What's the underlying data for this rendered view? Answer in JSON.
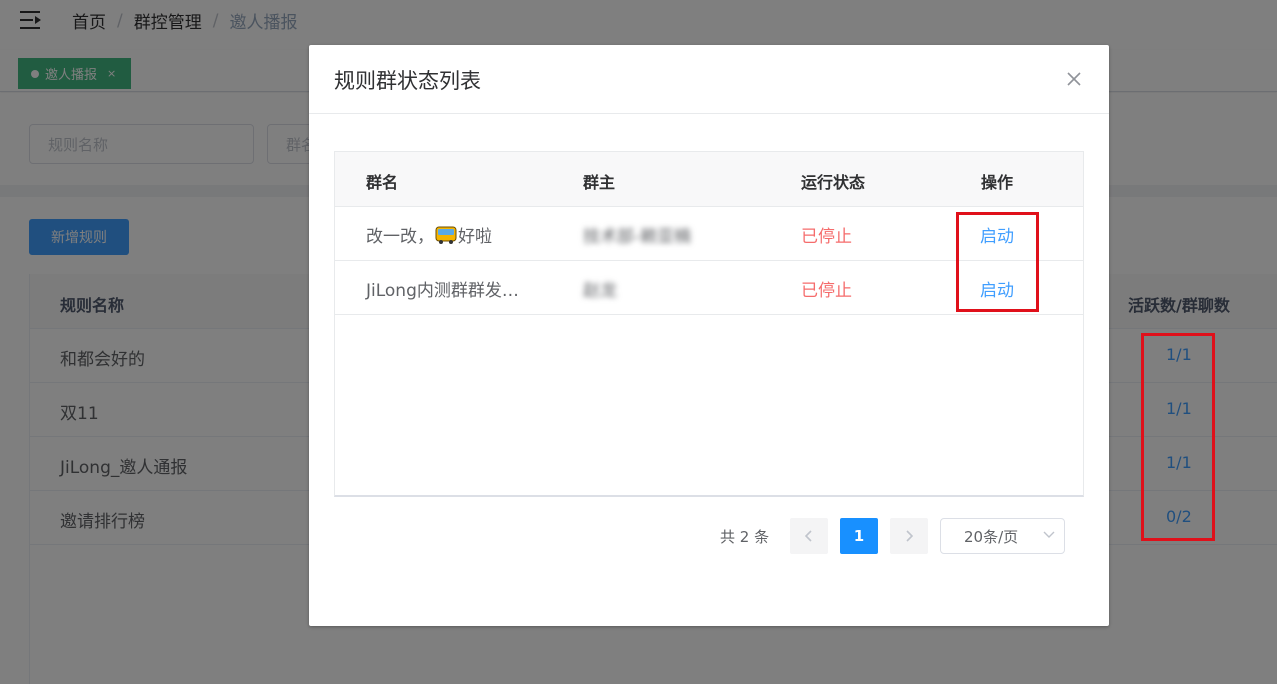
{
  "breadcrumb": {
    "home": "首页",
    "section": "群控管理",
    "current": "邀人播报"
  },
  "tags": {
    "active_label": "邀人播报",
    "close_glyph": "×"
  },
  "filters": {
    "rule_name_placeholder": "规则名称",
    "group_placeholder_partial": "群名"
  },
  "toolbar": {
    "add_rule_label": "新增规则"
  },
  "rules_table": {
    "headers": {
      "name": "规则名称",
      "active_count": "活跃数/群聊数"
    },
    "rows": [
      {
        "name": "和都会好的",
        "active": "1/1"
      },
      {
        "name": "双11",
        "active": "1/1"
      },
      {
        "name": "JiLong_邀人通报",
        "active": "1/1"
      },
      {
        "name": "邀请排行榜",
        "active": "0/2"
      }
    ]
  },
  "dialog": {
    "title": "规则群状态列表",
    "table": {
      "headers": {
        "group_name": "群名",
        "owner": "群主",
        "status": "运行状态",
        "action": "操作"
      },
      "rows": [
        {
          "group_name_prefix": "改一改，",
          "group_name_suffix": "好啦",
          "owner": "技术部-赖亚楠",
          "status": "已停止",
          "action": "启动"
        },
        {
          "group_name": "JiLong内测群群发…",
          "owner": "赵龙",
          "status": "已停止",
          "action": "启动"
        }
      ]
    },
    "pagination": {
      "total": "共 2 条",
      "current_page": "1",
      "page_size": "20条/页"
    }
  },
  "icons": {
    "hamburger": "hamburger-icon",
    "close": "close-icon",
    "prev": "chevron-left-icon",
    "next": "chevron-right-icon",
    "dropdown": "chevron-down-icon",
    "bus_emoji": "bus-emoji-icon"
  },
  "colors": {
    "primary": "#409eff",
    "danger": "#f56c6c",
    "tag": "#42b983",
    "highlight_box": "#e0101a"
  }
}
